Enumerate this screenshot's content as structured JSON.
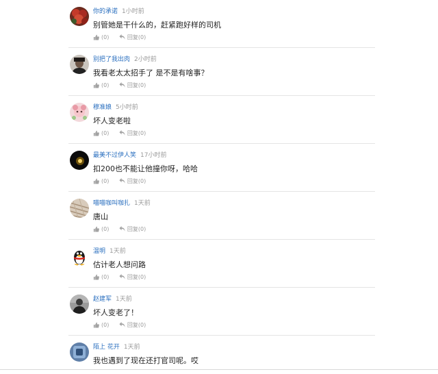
{
  "comments": [
    {
      "username": "你的承诺",
      "time": "1小时前",
      "content": "别管她是干什么的，赶紧跑好样的司机",
      "like_count": "(0)",
      "reply_label": "回复(0)",
      "avatar": "flower-photo"
    },
    {
      "username": "别把了我出肉",
      "time": "2小时前",
      "content": "我看老太太招手了  是不是有啥事？",
      "like_count": "(0)",
      "reply_label": "回复(0)",
      "avatar": "man-photo"
    },
    {
      "username": "穆准娘",
      "time": "5小时前",
      "content": "坏人变老啦",
      "like_count": "(0)",
      "reply_label": "回复(0)",
      "avatar": "pink-character"
    },
    {
      "username": "最美不过伊人笑",
      "time": "17小时前",
      "content": "扣200也不能让他撞你呀，哈哈",
      "like_count": "(0)",
      "reply_label": "回复(0)",
      "avatar": "dark-light-photo"
    },
    {
      "username": "喵喵咖叫咖扎",
      "time": "1天前",
      "content": "唐山",
      "like_count": "(0)",
      "reply_label": "回复(0)",
      "avatar": "beige-texture"
    },
    {
      "username": "温明",
      "time": "1天前",
      "content": "估计老人想问路",
      "like_count": "(0)",
      "reply_label": "回复(0)",
      "avatar": "qq-penguin"
    },
    {
      "username": "赵建军",
      "time": "1天前",
      "content": "坏人变老了！",
      "like_count": "(0)",
      "reply_label": "回复(0)",
      "avatar": "person-photo"
    },
    {
      "username": "陌上  花开",
      "time": "1天前",
      "content": "我也遇到了现在还打官司呢。哎",
      "like_count": "(0)",
      "reply_label": "回复(0)",
      "avatar": "blue-badge"
    }
  ],
  "icons": {
    "like": "thumbs-up-icon",
    "reply": "reply-arrow-icon"
  },
  "colors": {
    "username": "#2a6fbf",
    "meta": "#999999",
    "divider": "#e4e4e4"
  }
}
